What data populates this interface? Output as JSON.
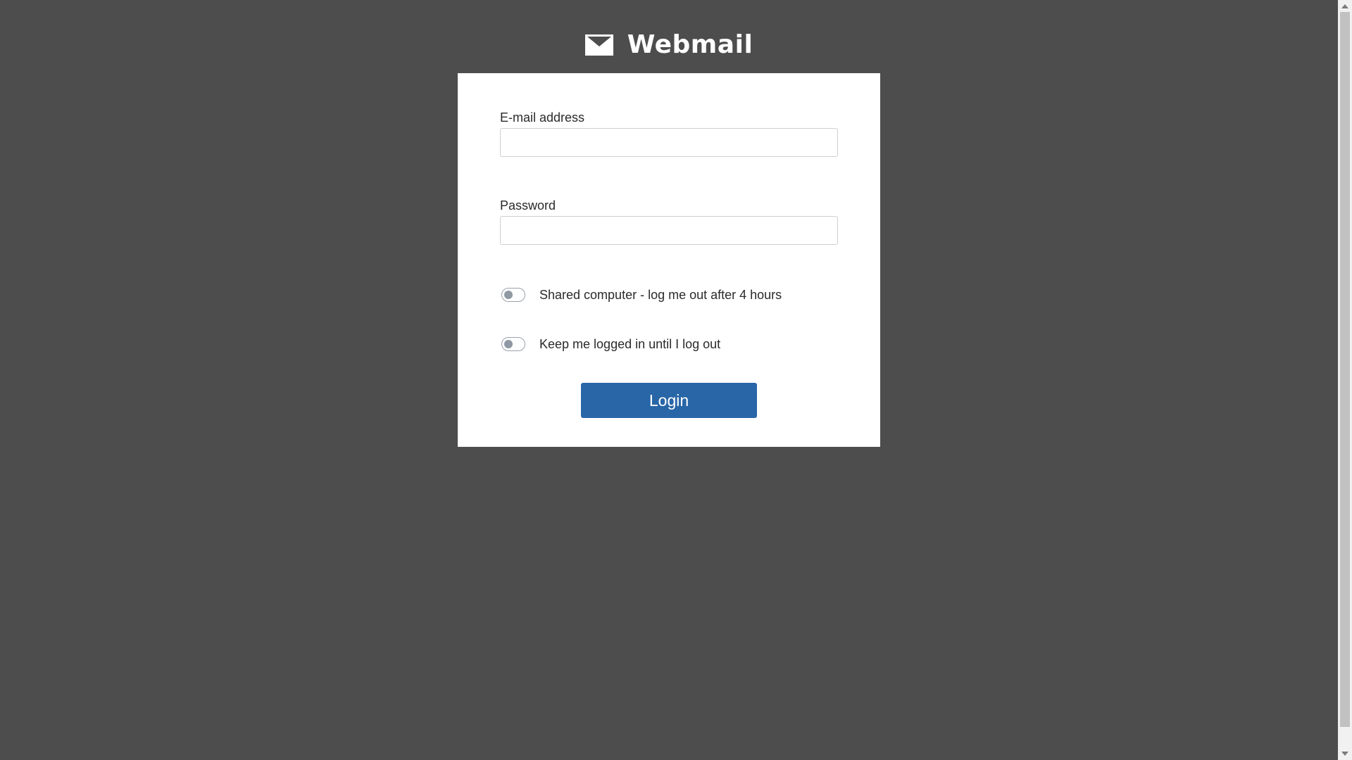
{
  "brand": {
    "title": "Webmail",
    "icon": "envelope-icon",
    "color": "#ffffff"
  },
  "form": {
    "email": {
      "label": "E-mail address",
      "value": "",
      "placeholder": ""
    },
    "password": {
      "label": "Password",
      "value": "",
      "placeholder": ""
    },
    "toggles": [
      {
        "label": "Shared computer - log me out after 4 hours",
        "checked": false
      },
      {
        "label": "Keep me logged in until I log out",
        "checked": false
      }
    ],
    "login_label": "Login"
  },
  "colors": {
    "background": "#4d4d4d",
    "card": "#ffffff",
    "accent": "#2866a7"
  }
}
